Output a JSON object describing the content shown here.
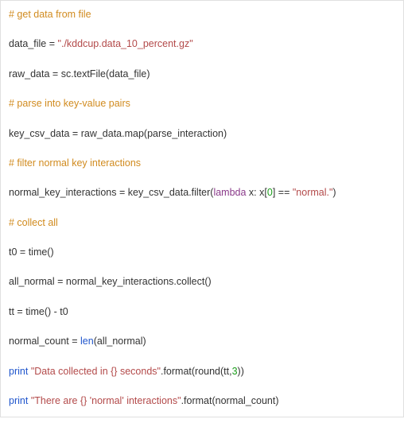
{
  "code": {
    "c1": "# get data from file",
    "l1a": "data_file ",
    "l1b": "=",
    "l1c": " ",
    "l1d": "\"./kddcup.data_10_percent.gz\"",
    "l2a": "raw_data ",
    "l2b": "=",
    "l2c": " sc.textFile(data_file)",
    "c2": "# parse into key-value pairs",
    "l3a": "key_csv_data ",
    "l3b": "=",
    "l3c": " raw_data.map(parse_interaction)",
    "c3": "# filter normal key interactions",
    "l4a": "normal_key_interactions ",
    "l4b": "=",
    "l4c": " key_csv_data.filter(",
    "l4d": "lambda",
    "l4e": " x: x[",
    "l4f": "0",
    "l4g": "] ",
    "l4h": "==",
    "l4i": " ",
    "l4j": "\"normal.\"",
    "l4k": ")",
    "c4": "# collect all",
    "l5a": "t0 ",
    "l5b": "=",
    "l5c": " time()",
    "l6a": "all_normal ",
    "l6b": "=",
    "l6c": " normal_key_interactions.collect()",
    "l7a": "tt ",
    "l7b": "=",
    "l7c": " time() ",
    "l7d": "-",
    "l7e": " t0",
    "l8a": "normal_count ",
    "l8b": "=",
    "l8c": " ",
    "l8d": "len",
    "l8e": "(all_normal)",
    "l9a": "print",
    "l9b": " ",
    "l9c": "\"Data collected in {} seconds\"",
    "l9d": ".format(round(tt,",
    "l9e": "3",
    "l9f": "))",
    "l10a": "print",
    "l10b": " ",
    "l10c": "\"There are {} 'normal' interactions\"",
    "l10d": ".format(normal_count)"
  }
}
